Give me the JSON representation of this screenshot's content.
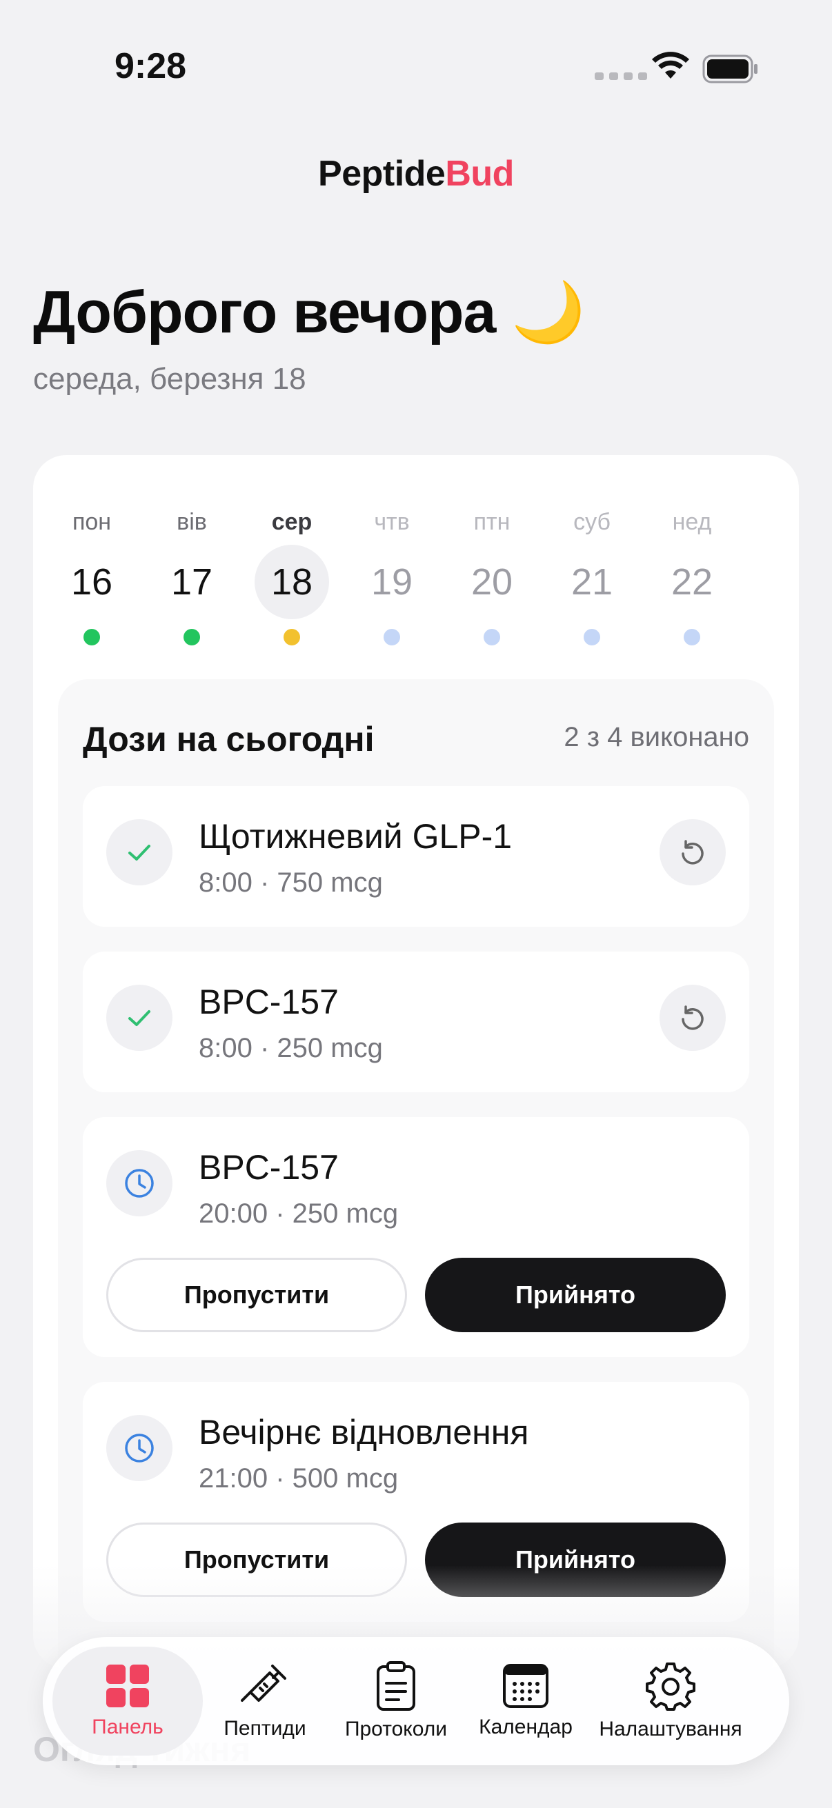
{
  "status_bar": {
    "time": "9:28"
  },
  "header": {
    "brand_part_1": "Peptide",
    "brand_part_2": "Bud"
  },
  "greeting": {
    "text": "Доброго вечора 🌙",
    "date": "середа, березня 18"
  },
  "week": [
    {
      "name": "пон",
      "num": "16",
      "status": "done"
    },
    {
      "name": "вів",
      "num": "17",
      "status": "done"
    },
    {
      "name": "сер",
      "num": "18",
      "status": "partial"
    },
    {
      "name": "чтв",
      "num": "19",
      "status": "future"
    },
    {
      "name": "птн",
      "num": "20",
      "status": "future"
    },
    {
      "name": "суб",
      "num": "21",
      "status": "future"
    },
    {
      "name": "нед",
      "num": "22",
      "status": "future"
    }
  ],
  "colors": {
    "accent": "#f0435f",
    "done": "#22c55e",
    "partial": "#f2c12e",
    "future": "#c4d6f7",
    "dark_button": "#161618",
    "check": "#2fbf71",
    "clock": "#3b82e0"
  },
  "doses": {
    "title": "Дози на сьогодні",
    "progress": "2 з 4 виконано",
    "items": [
      {
        "name": "Щотижневий GLP-1",
        "meta": "8:00 · 750 mcg",
        "state": "taken",
        "icon": "check-icon"
      },
      {
        "name": "BPC-157",
        "meta": "8:00 · 250 mcg",
        "state": "taken",
        "icon": "check-icon"
      },
      {
        "name": "BPC-157",
        "meta": "20:00 · 250 mcg",
        "state": "pending",
        "icon": "clock-icon",
        "skip_label": "Пропустити",
        "take_label": "Прийнято"
      },
      {
        "name": "Вечірнє відновлення",
        "meta": "21:00 · 500 mcg",
        "state": "pending",
        "icon": "clock-icon",
        "skip_label": "Пропустити",
        "take_label": "Прийнято"
      }
    ]
  },
  "faint_section_title": "Огляд тижня",
  "tabs": [
    {
      "label": "Панель",
      "icon": "dashboard-grid-icon",
      "active": true
    },
    {
      "label": "Пептиди",
      "icon": "syringe-icon",
      "active": false
    },
    {
      "label": "Протоколи",
      "icon": "clipboard-icon",
      "active": false
    },
    {
      "label": "Календар",
      "icon": "calendar-icon",
      "active": false
    },
    {
      "label": "Налаштування",
      "icon": "gear-icon",
      "active": false
    }
  ]
}
